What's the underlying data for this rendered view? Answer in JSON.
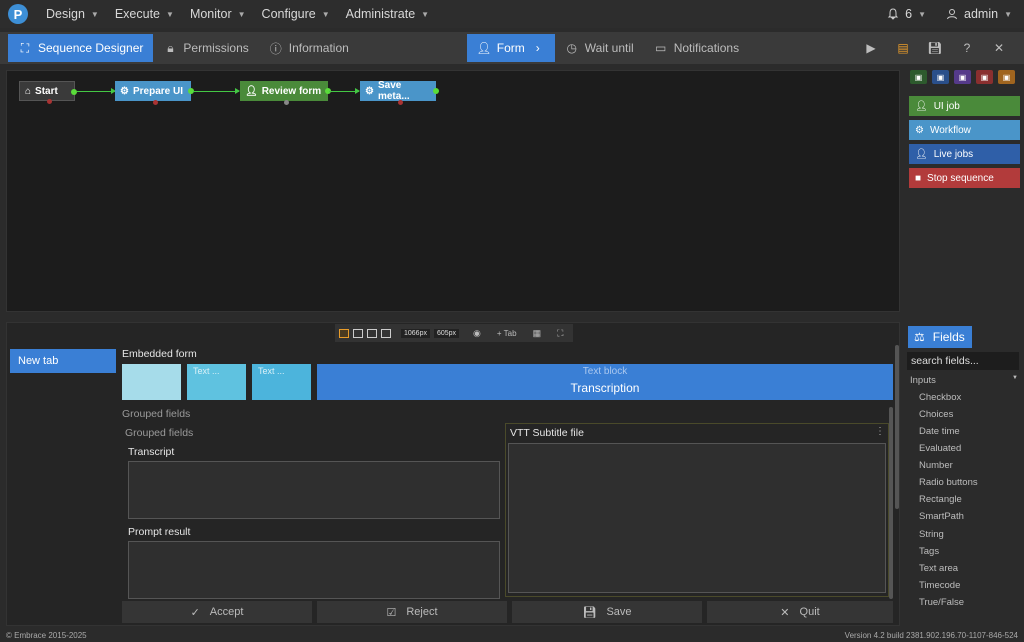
{
  "nav": {
    "logo_letter": "P",
    "items": [
      "Design",
      "Execute",
      "Monitor",
      "Configure",
      "Administrate"
    ],
    "notifications_count": "6",
    "user": "admin"
  },
  "toolbar": {
    "tabs": {
      "sequence_designer": "Sequence Designer",
      "permissions": "Permissions",
      "information": "Information",
      "form": "Form",
      "wait_until": "Wait until",
      "notifications": "Notifications"
    }
  },
  "canvas": {
    "nodes": [
      "Start",
      "Prepare UI",
      "Review form",
      "Save meta..."
    ]
  },
  "side_actions": {
    "ui_job": "UI job",
    "workflow": "Workflow",
    "live_jobs": "Live jobs",
    "stop_sequence": "Stop sequence"
  },
  "designer": {
    "width_px": "1066px",
    "height_px": "605px",
    "add_tab": "+ Tab",
    "tab_name": "New tab",
    "embedded_form": "Embedded form",
    "mini_cells": [
      "Text ...",
      "Text ..."
    ],
    "text_block_label": "Text block",
    "text_block_title": "Transcription",
    "grouped_fields_outer": "Grouped fields",
    "grouped_fields_inner": "Grouped fields",
    "transcript": "Transcript",
    "prompt_result": "Prompt result",
    "vtt_subtitle": "VTT Subtitle file",
    "buttons": {
      "accept": "Accept",
      "reject": "Reject",
      "save": "Save",
      "quit": "Quit"
    }
  },
  "fields_panel": {
    "title": "Fields",
    "search_value": "search fields...",
    "inputs_header": "Inputs",
    "items": [
      "Checkbox",
      "Choices",
      "Date time",
      "Evaluated",
      "Number",
      "Radio buttons",
      "Rectangle",
      "SmartPath",
      "String",
      "Tags",
      "Text area",
      "Timecode",
      "True/False"
    ]
  },
  "footer": {
    "copyright": "© Embrace 2015-2025",
    "version": "Version 4.2 build 2381.902.196.70-1107-846-524"
  },
  "colors": {
    "accent": "#3a7fd5",
    "ui_job": "#4a8a3a",
    "workflow": "#4a95c9",
    "live_jobs": "#2f5fa8",
    "stop_sequence": "#b23b3b"
  }
}
